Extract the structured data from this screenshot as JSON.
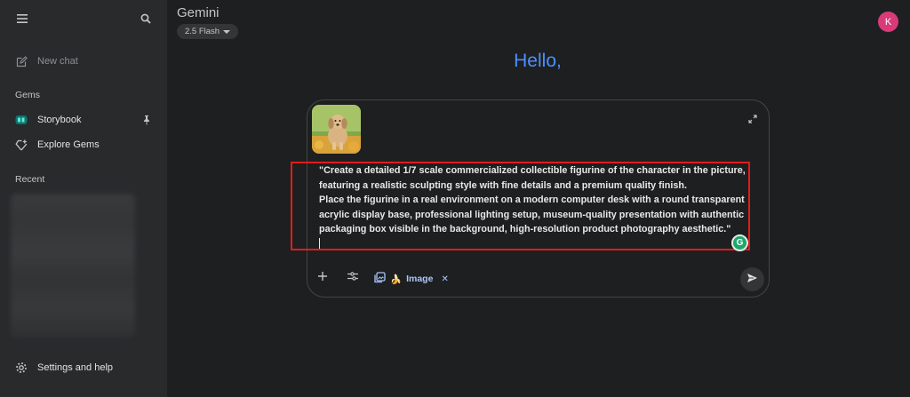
{
  "header": {
    "title": "Gemini",
    "model": "2.5 Flash",
    "avatar_initial": "K"
  },
  "sidebar": {
    "new_chat": "New chat",
    "gems_heading": "Gems",
    "gems": [
      {
        "label": "Storybook",
        "icon": "storybook-icon"
      },
      {
        "label": "Explore Gems",
        "icon": "gem-plus-icon"
      }
    ],
    "recent_heading": "Recent",
    "settings": "Settings and help"
  },
  "main": {
    "greeting": "Hello,",
    "prompt_lines": [
      "\"Create a detailed 1/7 scale commercialized collectible figurine of the character in the picture,",
      "featuring a realistic sculpting style with fine details and a premium quality finish.",
      "Place the figurine in a real environment on a modern computer desk with a round transparent",
      "acrylic display base, professional lighting setup, museum-quality presentation with authentic",
      "packaging box visible in the background, high-resolution product photography aesthetic.\""
    ],
    "attachment": {
      "icon": "dog-photo-thumbnail"
    },
    "toolbar": {
      "image_label": "Image",
      "image_emoji": "🍌",
      "remove_symbol": "✕"
    }
  },
  "colors": {
    "accent": "#4b90ff",
    "highlight": "#e21b1b",
    "sidebar": "#282a2c",
    "background": "#1e1f20"
  }
}
